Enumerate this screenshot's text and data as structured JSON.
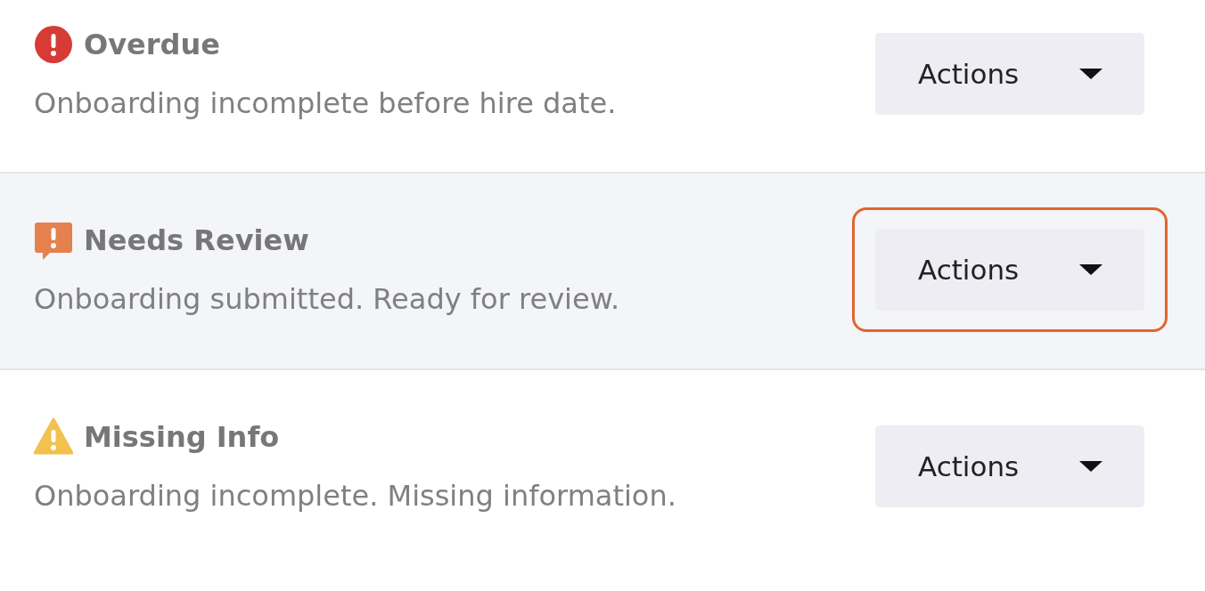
{
  "items": [
    {
      "kind": "error",
      "title": "Overdue",
      "description": "Onboarding incomplete before hire date.",
      "highlighted": false,
      "button": {
        "label": "Actions",
        "focused": false
      }
    },
    {
      "kind": "review",
      "title": "Needs Review",
      "description": "Onboarding submitted. Ready for review.",
      "highlighted": true,
      "button": {
        "label": "Actions",
        "focused": true
      }
    },
    {
      "kind": "warning",
      "title": "Missing Info",
      "description": "Onboarding incomplete. Missing information.",
      "highlighted": false,
      "button": {
        "label": "Actions",
        "focused": false
      }
    }
  ]
}
